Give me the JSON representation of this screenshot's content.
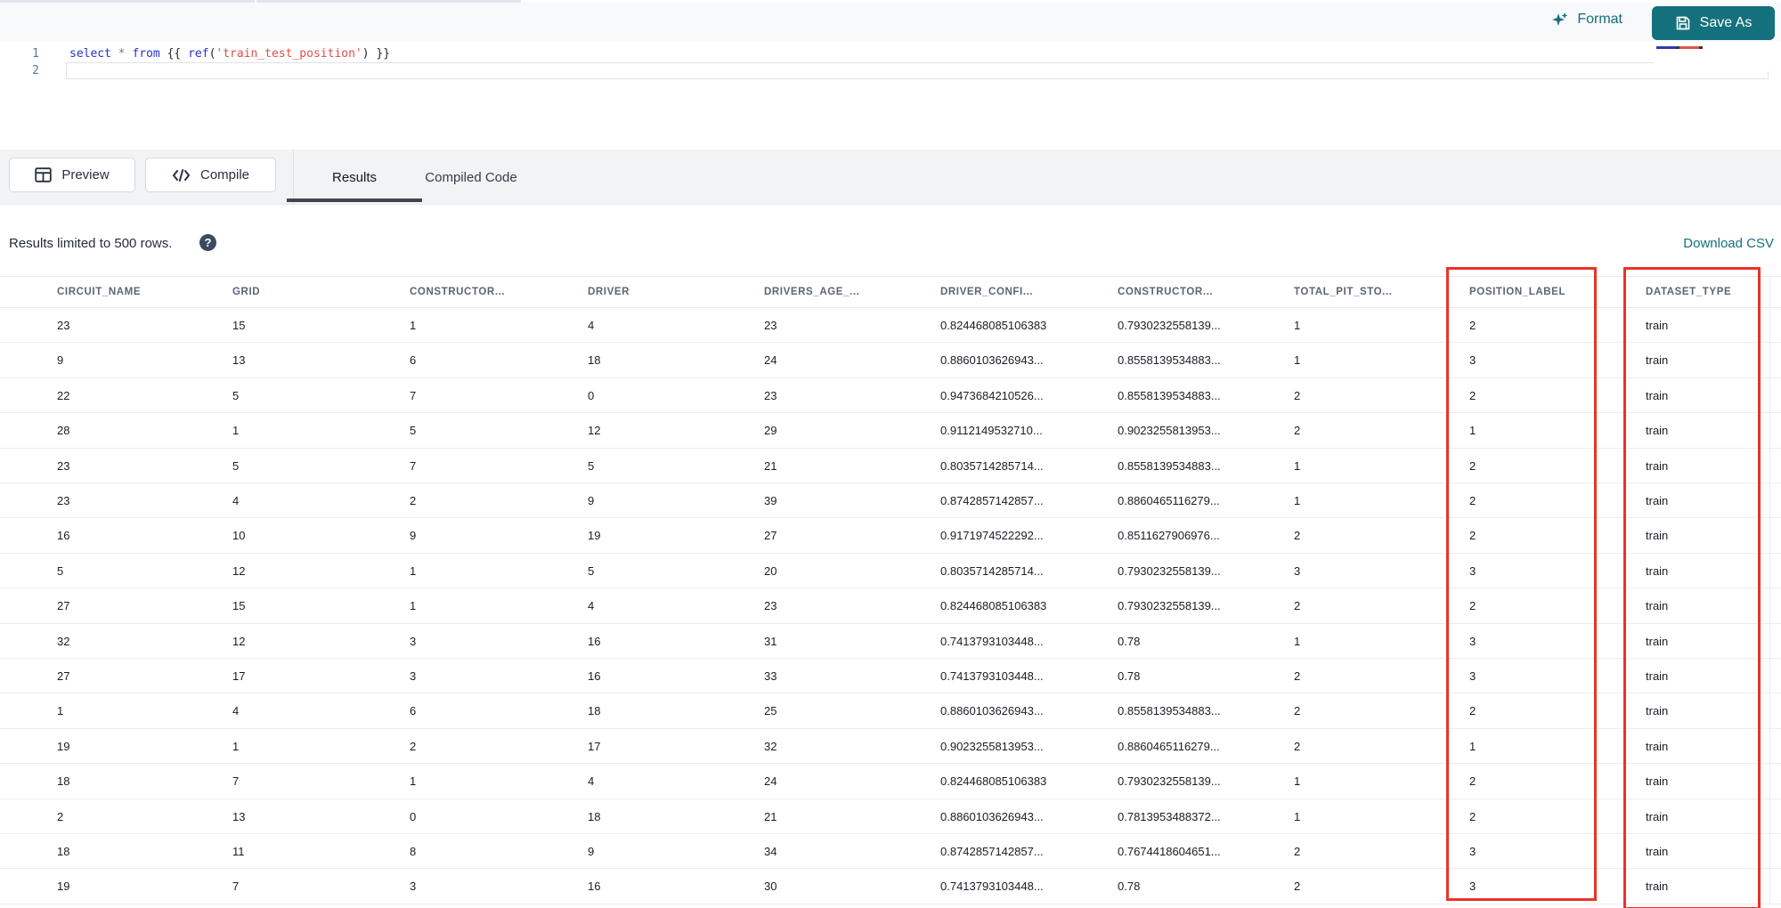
{
  "toolbar": {
    "format_label": "Format",
    "save_as_label": "Save As"
  },
  "editor": {
    "lines": [
      {
        "number": "1",
        "tokens": [
          {
            "text": "select ",
            "type": "keyword"
          },
          {
            "text": "* ",
            "type": "operator"
          },
          {
            "text": "from ",
            "type": "keyword"
          },
          {
            "text": "{{ ",
            "type": "bracket"
          },
          {
            "text": "ref",
            "type": "function"
          },
          {
            "text": "(",
            "type": "bracket"
          },
          {
            "text": "'train_test_position'",
            "type": "string"
          },
          {
            "text": ")",
            "type": "bracket"
          },
          {
            "text": " }}",
            "type": "bracket"
          }
        ]
      },
      {
        "number": "2",
        "tokens": []
      }
    ]
  },
  "actions": {
    "preview_label": "Preview",
    "compile_label": "Compile"
  },
  "result_tabs": [
    {
      "label": "Results",
      "active": true
    },
    {
      "label": "Compiled Code",
      "active": false
    }
  ],
  "results_bar": {
    "limit_text": "Results limited to 500 rows.",
    "help_icon": "question-mark-icon",
    "download_label": "Download CSV"
  },
  "icons": {
    "format": "sparkles-icon",
    "save_as": "floppy-disk-icon",
    "preview": "table-grid-icon",
    "compile": "code-brackets-icon"
  },
  "table": {
    "columns": [
      "CIRCUIT_NAME",
      "GRID",
      "CONSTRUCTOR...",
      "DRIVER",
      "DRIVERS_AGE_...",
      "DRIVER_CONFI...",
      "CONSTRUCTOR...",
      "TOTAL_PIT_STO...",
      "POSITION_LABEL",
      "DATASET_TYPE"
    ],
    "highlighted_columns": [
      "POSITION_LABEL",
      "DATASET_TYPE"
    ],
    "rows": [
      [
        "23",
        "15",
        "1",
        "4",
        "23",
        "0.824468085106383",
        "0.7930232558139...",
        "1",
        "2",
        "train"
      ],
      [
        "9",
        "13",
        "6",
        "18",
        "24",
        "0.8860103626943...",
        "0.8558139534883...",
        "1",
        "3",
        "train"
      ],
      [
        "22",
        "5",
        "7",
        "0",
        "23",
        "0.9473684210526...",
        "0.8558139534883...",
        "2",
        "2",
        "train"
      ],
      [
        "28",
        "1",
        "5",
        "12",
        "29",
        "0.9112149532710...",
        "0.9023255813953...",
        "2",
        "1",
        "train"
      ],
      [
        "23",
        "5",
        "7",
        "5",
        "21",
        "0.8035714285714...",
        "0.8558139534883...",
        "1",
        "2",
        "train"
      ],
      [
        "23",
        "4",
        "2",
        "9",
        "39",
        "0.8742857142857...",
        "0.8860465116279...",
        "1",
        "2",
        "train"
      ],
      [
        "16",
        "10",
        "9",
        "19",
        "27",
        "0.9171974522292...",
        "0.8511627906976...",
        "2",
        "2",
        "train"
      ],
      [
        "5",
        "12",
        "1",
        "5",
        "20",
        "0.8035714285714...",
        "0.7930232558139...",
        "3",
        "3",
        "train"
      ],
      [
        "27",
        "15",
        "1",
        "4",
        "23",
        "0.824468085106383",
        "0.7930232558139...",
        "2",
        "2",
        "train"
      ],
      [
        "32",
        "12",
        "3",
        "16",
        "31",
        "0.7413793103448...",
        "0.78",
        "1",
        "3",
        "train"
      ],
      [
        "27",
        "17",
        "3",
        "16",
        "33",
        "0.7413793103448...",
        "0.78",
        "2",
        "3",
        "train"
      ],
      [
        "1",
        "4",
        "6",
        "18",
        "25",
        "0.8860103626943...",
        "0.8558139534883...",
        "2",
        "2",
        "train"
      ],
      [
        "19",
        "1",
        "2",
        "17",
        "32",
        "0.9023255813953...",
        "0.8860465116279...",
        "2",
        "1",
        "train"
      ],
      [
        "18",
        "7",
        "1",
        "4",
        "24",
        "0.824468085106383",
        "0.7930232558139...",
        "1",
        "2",
        "train"
      ],
      [
        "2",
        "13",
        "0",
        "18",
        "21",
        "0.8860103626943...",
        "0.7813953488372...",
        "1",
        "2",
        "train"
      ],
      [
        "18",
        "11",
        "8",
        "9",
        "34",
        "0.8742857142857...",
        "0.7674418604651...",
        "2",
        "3",
        "train"
      ],
      [
        "19",
        "7",
        "3",
        "16",
        "30",
        "0.7413793103448...",
        "0.78",
        "2",
        "3",
        "train"
      ]
    ]
  },
  "colors": {
    "accent_teal": "#14707c",
    "highlight_red": "#ea3327",
    "code_keyword": "#2433c8",
    "code_string": "#df4f48"
  }
}
